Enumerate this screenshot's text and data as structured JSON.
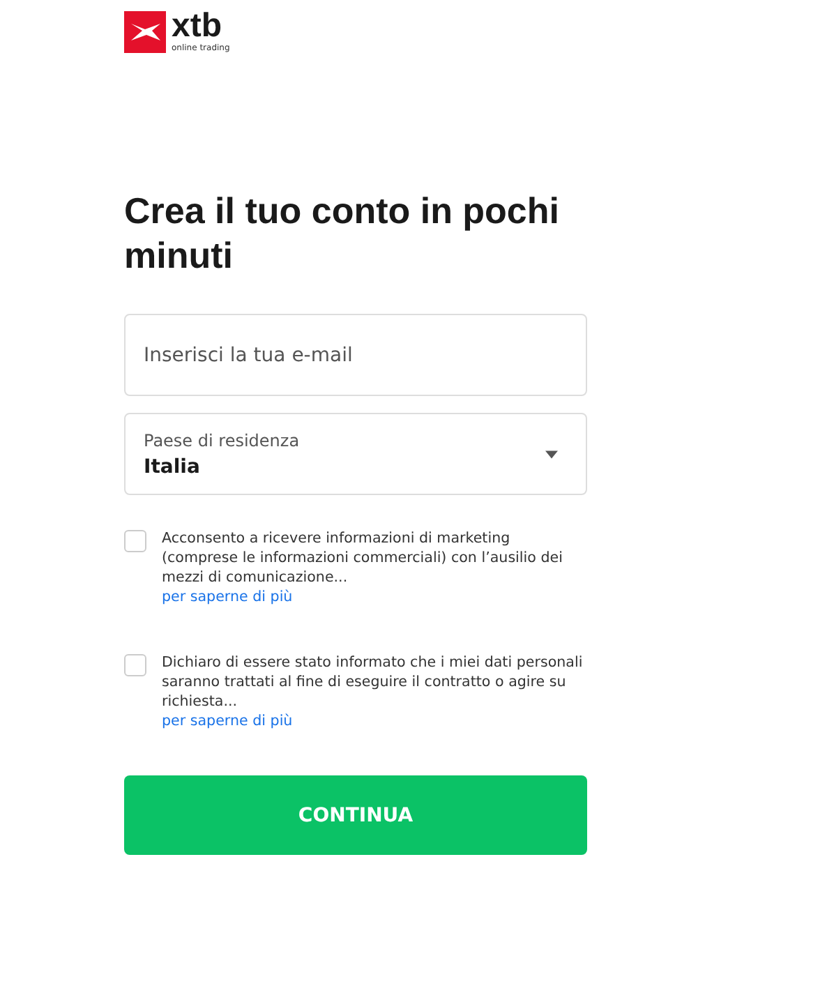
{
  "logo": {
    "wordmark": "xtb",
    "tagline": "online trading"
  },
  "title": "Crea il tuo conto in pochi minuti",
  "email": {
    "placeholder": "Inserisci la tua e-mail"
  },
  "country": {
    "label": "Paese di residenza",
    "value": "Italia"
  },
  "consents": [
    {
      "text": "Acconsento a ricevere informazioni di marketing (comprese le informazioni commerciali) con l’ausilio dei mezzi di comunicazione...",
      "link": "per saperne di più",
      "checked": false
    },
    {
      "text": "Dichiaro di essere stato informato che i miei dati personali saranno trattati al fine di eseguire il contratto o agire su richiesta...",
      "link": "per saperne di più",
      "checked": false
    }
  ],
  "button": "CONTINUA"
}
